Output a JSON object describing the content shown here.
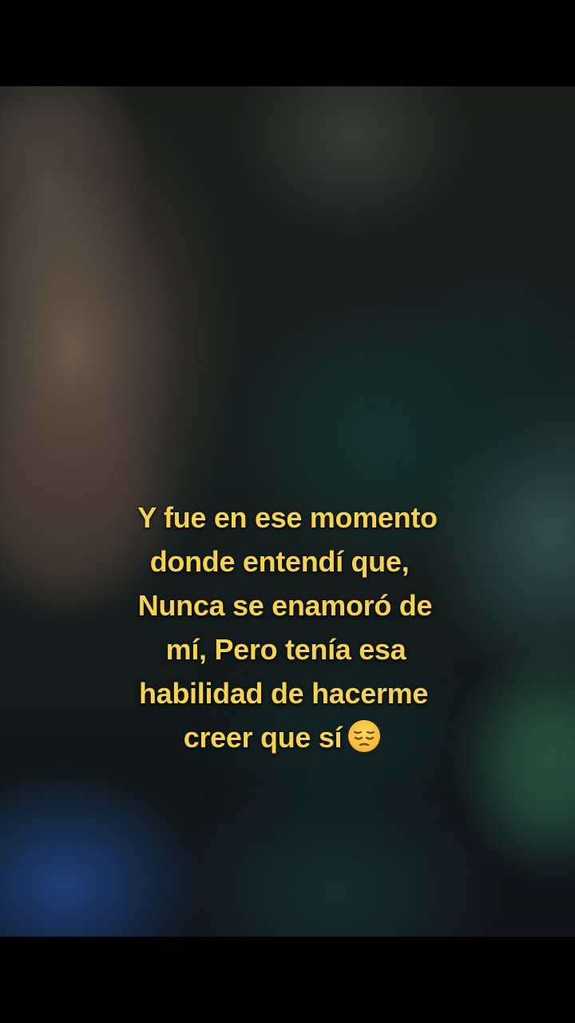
{
  "caption": {
    "line_1": "Y fue en ese momento",
    "line_2": "donde entendí que,",
    "line_3": "Nunca se enamoró de",
    "line_4": "mí, Pero tenía esa",
    "line_5": "habilidad de hacerme",
    "line_6": "creer que sí",
    "emoji": "pensive-face-icon"
  },
  "colors": {
    "caption_text": "#f5d34a",
    "letterbox": "#000000"
  }
}
